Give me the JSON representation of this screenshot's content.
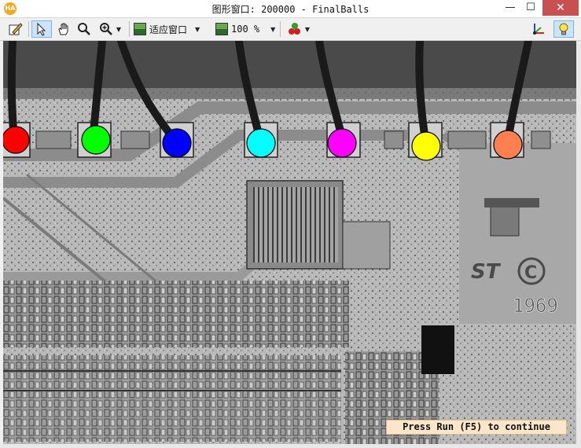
{
  "window": {
    "title": "图形窗口: 200000 - FinalBalls",
    "app_icon_text": "HA",
    "minimize": "—",
    "maximize": "☐",
    "close": "✕"
  },
  "toolbar": {
    "fit_label": "适应窗口",
    "zoom_label": "100 %"
  },
  "image": {
    "logo_text": "ST",
    "year_text": "1969",
    "ball_colors": [
      "#ff0000",
      "#00ff00",
      "#0000ff",
      "#00ffff",
      "#ff00ff",
      "#ffff00",
      "#ff7f50"
    ]
  },
  "status": {
    "message": "Press Run (F5) to continue"
  }
}
